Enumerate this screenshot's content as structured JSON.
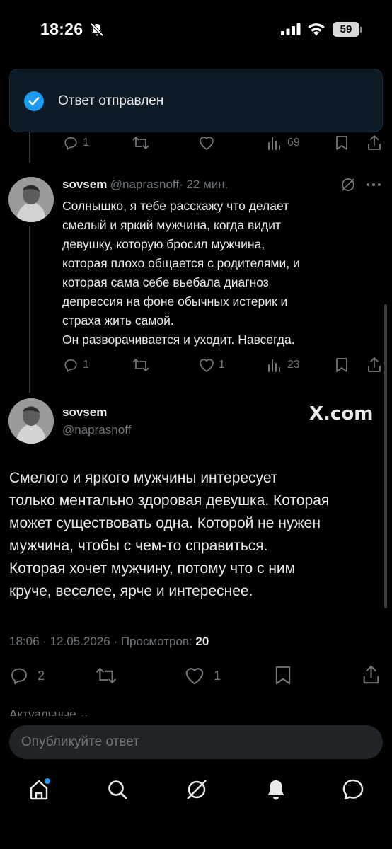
{
  "status_bar": {
    "time": "18:26",
    "battery": "59"
  },
  "toast": {
    "message": "Ответ отправлен"
  },
  "prev_tweet": {
    "replies": "1",
    "views": "69"
  },
  "reply_tweet": {
    "name": "sovsem",
    "handle": "@naprasnoff",
    "time": "· 22 мин.",
    "text": "Солнышко, я тебе расскажу что делает\nсмелый и яркий мужчина, когда видит\nдевушку, которую бросил мужчина,\nкоторая плохо общается с родителями, и\nкоторая сама себе вьебала диагноз\nдепрессия на фоне обычных истерик и\nстраха жить самой.\nОн разворачивается и уходит. Навсегда.",
    "replies": "1",
    "likes": "1",
    "views": "23"
  },
  "main_tweet": {
    "name": "sovsem",
    "handle": "@naprasnoff",
    "source_logo": "X.com",
    "text": "Смелого и яркого мужчины интересует\nтолько ментально здоровая девушка. Которая\nможет существовать одна. Которой не нужен\nмужчина, чтобы с чем-то справиться.\nКоторая хочет мужчину, потому что с ним\nкруче, веселее, ярче и интереснее.",
    "timestamp": "18:06 · 12.05.2026 · Просмотров: ",
    "views": "20",
    "replies": "2",
    "likes": "1"
  },
  "sort_label": "Актуальные ⌄",
  "reply_box": {
    "placeholder": "Опубликуйте ответ"
  },
  "bottom_nav": [
    "home-icon",
    "search-icon",
    "grok-icon",
    "notifications-icon",
    "messages-icon"
  ],
  "colors": {
    "accent": "#1d9bf0",
    "muted": "#71767b",
    "text": "#e7e9ea",
    "background": "#000000"
  }
}
